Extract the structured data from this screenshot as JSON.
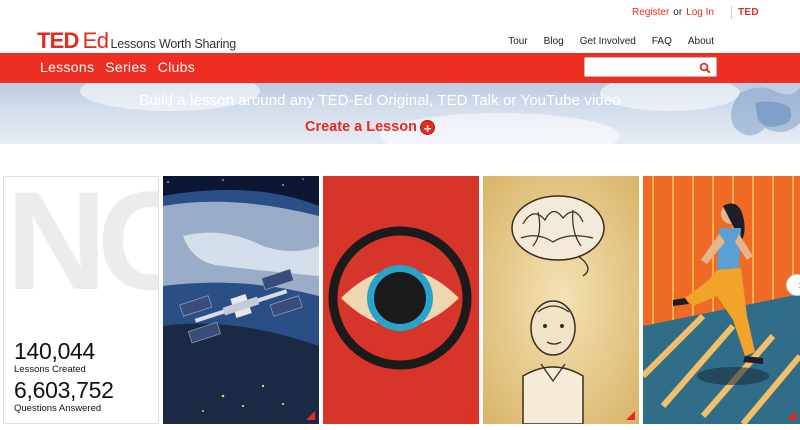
{
  "utility": {
    "register": "Register",
    "or": "or",
    "login": "Log In",
    "ted": "TED"
  },
  "logo": {
    "ted": "TED",
    "ed": "Ed",
    "tagline": "Lessons Worth Sharing"
  },
  "topnav": [
    "Tour",
    "Blog",
    "Get Involved",
    "FAQ",
    "About"
  ],
  "rednav": [
    "Lessons",
    "Series",
    "Clubs"
  ],
  "search": {
    "placeholder": "",
    "icon": "search-icon"
  },
  "banner": {
    "text": "Build a lesson around any TED-Ed Original, TED Talk or YouTube video",
    "cta": "Create a Lesson",
    "cta_icon": "plus-icon"
  },
  "stats": {
    "lessons_count": "140,044",
    "lessons_label": "Lessons Created",
    "questions_count": "6,603,752",
    "questions_label": "Questions Answered"
  },
  "tiles": [
    {
      "name": "space-station-lesson",
      "illustration": "space-station-over-earth"
    },
    {
      "name": "eye-lesson",
      "illustration": "eye-in-circle"
    },
    {
      "name": "brain-lesson",
      "illustration": "brain-and-old-man"
    },
    {
      "name": "runner-lesson",
      "illustration": "woman-running"
    }
  ],
  "colors": {
    "brand_red": "#e62b1e",
    "nav_red": "#ee2e22"
  }
}
